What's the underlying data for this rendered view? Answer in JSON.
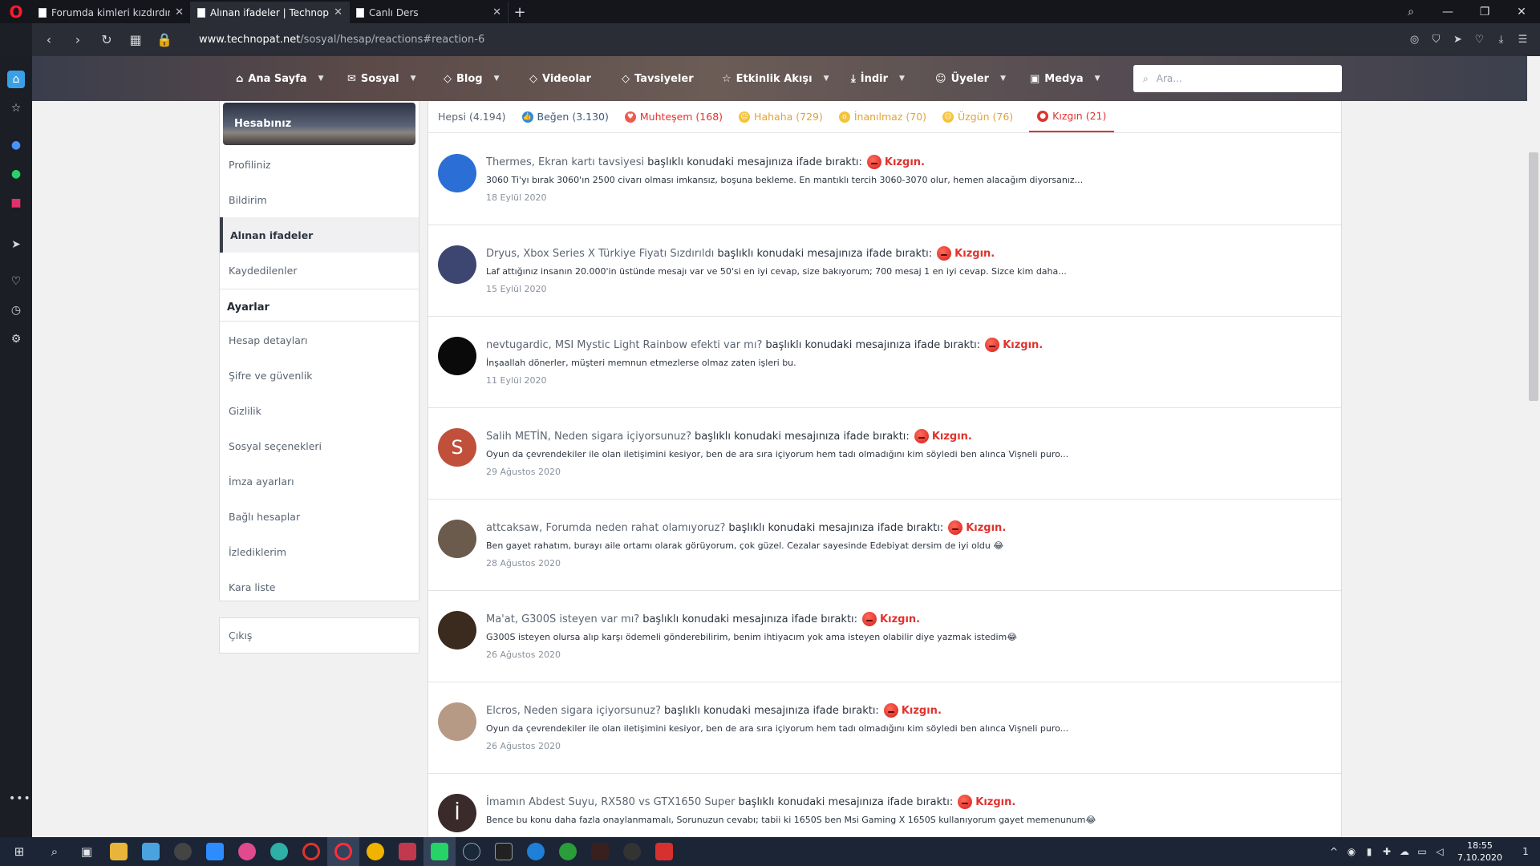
{
  "browser": {
    "tabs": [
      {
        "title": "Forumda kimleri kızdırdınız",
        "active": false
      },
      {
        "title": "Alınan ifadeler | Technopat",
        "active": true
      },
      {
        "title": "Canlı Ders",
        "active": false
      }
    ],
    "url_host": "www.technopat.net",
    "url_path": "/sosyal/hesap/reactions#reaction-6"
  },
  "site_nav": {
    "items": [
      {
        "label": "Ana Sayfa",
        "icon": "home-icon"
      },
      {
        "label": "Sosyal",
        "icon": "comments-icon"
      },
      {
        "label": "Blog",
        "icon": "tag-icon"
      },
      {
        "label": "Videolar",
        "icon": "tag-icon"
      },
      {
        "label": "Tavsiyeler",
        "icon": "tag-icon"
      },
      {
        "label": "Etkinlik Akışı",
        "icon": "star-icon"
      },
      {
        "label": "İndir",
        "icon": "download-icon"
      },
      {
        "label": "Üyeler",
        "icon": "user-icon"
      },
      {
        "label": "Medya",
        "icon": "image-icon"
      }
    ],
    "search_placeholder": "Ara..."
  },
  "account": {
    "title": "Hesabınız",
    "items": [
      "Profiliniz",
      "Bildirim",
      "Alınan ifadeler",
      "Kaydedilenler"
    ],
    "active_item": "Alınan ifadeler",
    "settings_header": "Ayarlar",
    "settings_items": [
      "Hesap detayları",
      "Şifre ve güvenlik",
      "Gizlilik",
      "Sosyal seçenekleri",
      "İmza ayarları",
      "Bağlı hesaplar",
      "İzlediklerim",
      "Kara liste"
    ],
    "logout": "Çıkış"
  },
  "reaction_tabs": [
    {
      "label": "Hepsi (4.194)",
      "kind": "all"
    },
    {
      "label": "Beğen (3.130)",
      "kind": "like"
    },
    {
      "label": "Muhteşem (168)",
      "kind": "love"
    },
    {
      "label": "Hahaha (729)",
      "kind": "haha"
    },
    {
      "label": "İnanılmaz (70)",
      "kind": "wow"
    },
    {
      "label": "Üzgün (76)",
      "kind": "sad"
    },
    {
      "label": "Kızgın (21)",
      "kind": "angry",
      "selected": true
    }
  ],
  "reactions": {
    "phrase": "başlıklı konudaki mesajınıza ifade bıraktı:",
    "reaction_label": "Kızgın.",
    "items": [
      {
        "who": "Thermes, Ekran kartı tavsiyesi",
        "excerpt": "3060 Ti'yı bırak 3060'ın 2500 civarı olması imkansız, boşuna bekleme. En mantıklı tercih 3060-3070 olur, hemen alacağım diyorsanız...",
        "date": "18 Eylül 2020",
        "avatar_letter": "",
        "avatar_color": "#2b6fd6"
      },
      {
        "who": "Dryus, Xbox Series X Türkiye Fiyatı Sızdırıldı",
        "excerpt": "Laf attığınız insanın 20.000'in üstünde mesajı var ve 50'si en iyi cevap, size bakıyorum; 700 mesaj 1 en iyi cevap. Sizce kim daha...",
        "date": "15 Eylül 2020",
        "avatar_letter": "",
        "avatar_color": "#3d4670"
      },
      {
        "who": "nevtugardic, MSI Mystic Light Rainbow efekti var mı?",
        "excerpt": "İnşaallah dönerler, müşteri memnun etmezlerse olmaz zaten işleri bu.",
        "date": "11 Eylül 2020",
        "avatar_letter": "",
        "avatar_color": "#0a0a0a"
      },
      {
        "who": "Salih METİN, Neden sigara içiyorsunuz?",
        "excerpt": "Oyun da çevrendekiler ile olan iletişimini kesiyor, ben de ara sıra içiyorum hem tadı olmadığını kim söyledi ben alınca Vişneli puro...",
        "date": "29 Ağustos 2020",
        "avatar_letter": "S",
        "avatar_color": "#c0503a"
      },
      {
        "who": "attcaksaw, Forumda neden rahat olamıyoruz?",
        "excerpt": "Ben gayet rahatım, burayı aile ortamı olarak görüyorum, çok güzel. Cezalar sayesinde Edebiyat dersim de iyi oldu 😂",
        "date": "28 Ağustos 2020",
        "avatar_letter": "",
        "avatar_color": "#6b5b4d"
      },
      {
        "who": "Ma'at, G300S isteyen var mı?",
        "excerpt": "G300S isteyen olursa alıp karşı ödemeli gönderebilirim, benim ihtiyacım yok ama isteyen olabilir diye yazmak istedim😂",
        "date": "26 Ağustos 2020",
        "avatar_letter": "",
        "avatar_color": "#3b2a1e"
      },
      {
        "who": "Elcros, Neden sigara içiyorsunuz?",
        "excerpt": "Oyun da çevrendekiler ile olan iletişimini kesiyor, ben de ara sıra içiyorum hem tadı olmadığını kim söyledi ben alınca Vişneli puro...",
        "date": "26 Ağustos 2020",
        "avatar_letter": "",
        "avatar_color": "#b79a86"
      },
      {
        "who": "İmamın Abdest Suyu, RX580 vs GTX1650 Super",
        "excerpt": "Bence bu konu daha fazla onaylanmamalı, Sorunuzun cevabı; tabii ki 1650S ben Msi Gaming X 1650S kullanıyorum gayet memenunum😂",
        "date": "",
        "avatar_letter": "İ",
        "avatar_color": "#3a2a2a"
      }
    ]
  },
  "taskbar": {
    "time": "18:55",
    "date": "7.10.2020",
    "notification_count": "1"
  }
}
